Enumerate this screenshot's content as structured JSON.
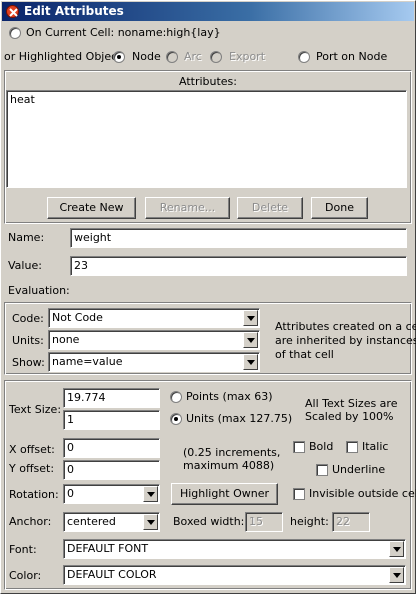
{
  "window": {
    "title": "Edit Attributes"
  },
  "scope": {
    "current_cell_label": "On Current Cell: noname:high{lay}",
    "highlighted_label": "or Highlighted Object:",
    "node_label": "Node",
    "arc_label": "Arc",
    "export_label": "Export",
    "port_label": "Port on Node"
  },
  "attributes": {
    "header": "Attributes:",
    "items": [
      "heat"
    ]
  },
  "buttons": {
    "create_new": "Create New",
    "rename": "Rename...",
    "delete": "Delete",
    "done": "Done",
    "highlight_owner": "Highlight Owner"
  },
  "fields": {
    "name_label": "Name:",
    "name_value": "weight",
    "value_label": "Value:",
    "value_value": "23"
  },
  "evaluation": {
    "label": "Evaluation:",
    "code_label": "Code:",
    "code_value": "Not Code",
    "units_label": "Units:",
    "units_value": "none",
    "show_label": "Show:",
    "show_value": "name=value",
    "note_lines": [
      "Attributes created on a cell",
      "are inherited by instances",
      "of that cell"
    ]
  },
  "text": {
    "size_label": "Text Size:",
    "size_points_value": "19.774",
    "size_units_value": "1",
    "points_label": "Points (max 63)",
    "units_label": "Units (max 127.75)",
    "scale_note_lines": [
      "All Text Sizes are",
      "Scaled by 100%"
    ],
    "xoffset_label": "X offset:",
    "xoffset_value": "0",
    "yoffset_label": "Y offset:",
    "yoffset_value": "0",
    "increments_lines": [
      "(0.25 increments,",
      "maximum 4088)"
    ],
    "bold_label": "Bold",
    "italic_label": "Italic",
    "underline_label": "Underline",
    "rotation_label": "Rotation:",
    "rotation_value": "0",
    "invisible_label": "Invisible outside cell",
    "anchor_label": "Anchor:",
    "anchor_value": "centered",
    "boxed_width_label": "Boxed width:",
    "boxed_width_value": "15",
    "height_label": "height:",
    "height_value": "22",
    "font_label": "Font:",
    "font_value": "DEFAULT FONT",
    "color_label": "Color:",
    "color_value": "DEFAULT COLOR"
  },
  "colors": {
    "titlebar_start": "#0a246a",
    "titlebar_end": "#a6caf0",
    "dialog_bg": "#d4d0c8"
  }
}
